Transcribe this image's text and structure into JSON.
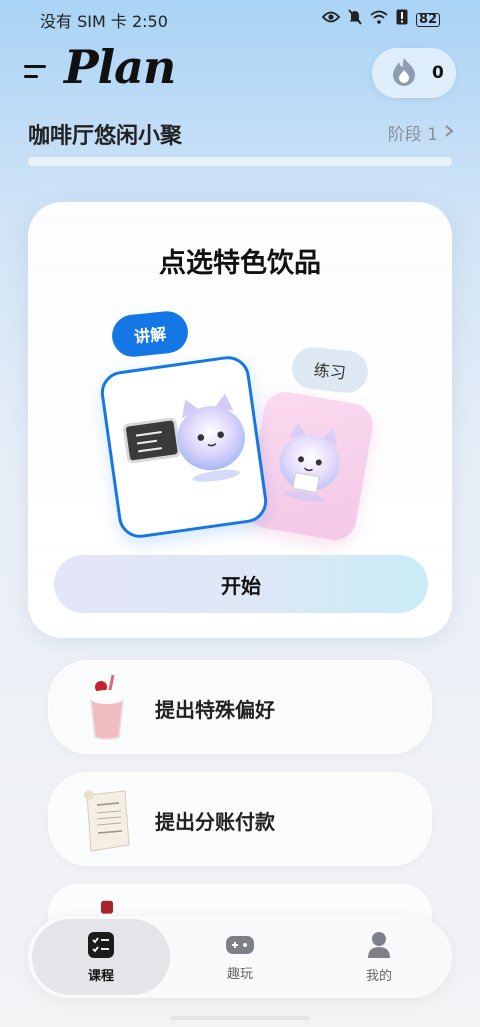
{
  "status_bar": {
    "time": "没有 SIM 卡 2:50",
    "battery": "82"
  },
  "header": {
    "logo": "Plan",
    "streak_count": "0"
  },
  "lesson": {
    "title": "咖啡厅悠闲小聚",
    "stage": "阶段 1",
    "progress_fraction": 0
  },
  "main_card": {
    "title": "点选特色饮品",
    "tag_explain": "讲解",
    "tag_practice": "练习",
    "start_button": "开始"
  },
  "list_items": [
    {
      "label": "提出特殊偏好",
      "icon": "milkshake-icon"
    },
    {
      "label": "提出分账付款",
      "icon": "receipt-icon"
    }
  ],
  "nav": {
    "items": [
      {
        "label": "课程",
        "icon": "checklist-icon"
      },
      {
        "label": "趣玩",
        "icon": "gamepad-icon"
      },
      {
        "label": "我的",
        "icon": "person-icon"
      }
    ]
  },
  "colors": {
    "accent": "#1577e6",
    "pink_card": "#f3c8e6"
  }
}
